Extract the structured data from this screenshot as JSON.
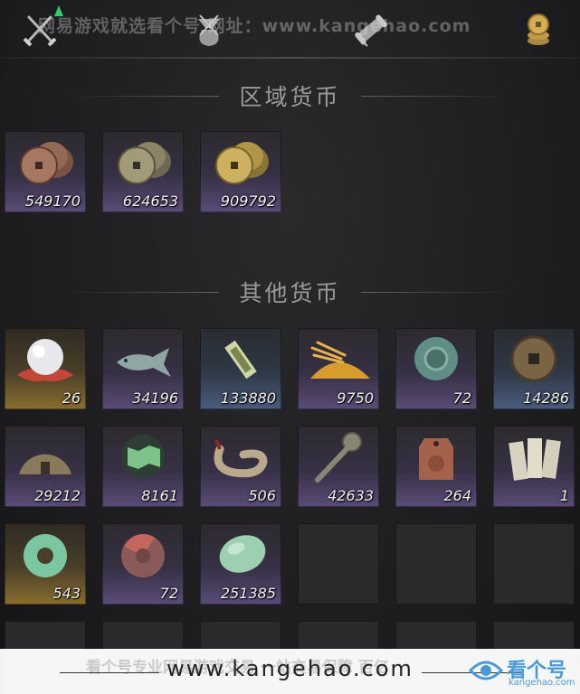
{
  "watermark": "网易游戏就选看个号  网址：www.kangehao.com",
  "tabs": [
    {
      "name": "swords-icon"
    },
    {
      "name": "pouch-icon"
    },
    {
      "name": "scroll-icon"
    },
    {
      "name": "coin-stack-icon"
    }
  ],
  "regional_currency": {
    "title": "区域货币",
    "items": [
      {
        "icon": "copper-coins-icon",
        "count": "549170",
        "rarity": "purple"
      },
      {
        "icon": "silver-coins-icon",
        "count": "624653",
        "rarity": "purple"
      },
      {
        "icon": "gold-coins-icon",
        "count": "909792",
        "rarity": "purple"
      }
    ]
  },
  "other_currency": {
    "title": "其他货币",
    "items": [
      {
        "icon": "pearl-icon",
        "count": "26",
        "rarity": "gold"
      },
      {
        "icon": "jade-fish-icon",
        "count": "34196",
        "rarity": "purple"
      },
      {
        "icon": "token-plaque-icon",
        "count": "133880",
        "rarity": "blue"
      },
      {
        "icon": "grain-pile-icon",
        "count": "9750",
        "rarity": "purple"
      },
      {
        "icon": "jade-disc-icon",
        "count": "72",
        "rarity": "purple"
      },
      {
        "icon": "bronze-coin-icon",
        "count": "14286",
        "rarity": "blue"
      },
      {
        "icon": "half-coin-icon",
        "count": "29212",
        "rarity": "purple"
      },
      {
        "icon": "green-map-icon",
        "count": "8161",
        "rarity": "purple"
      },
      {
        "icon": "coiled-rope-icon",
        "count": "506",
        "rarity": "purple"
      },
      {
        "icon": "coin-sword-icon",
        "count": "42633",
        "rarity": "purple"
      },
      {
        "icon": "copper-tag-icon",
        "count": "264",
        "rarity": "purple"
      },
      {
        "icon": "paper-slips-icon",
        "count": "1",
        "rarity": "purple"
      },
      {
        "icon": "jade-ring-icon",
        "count": "543",
        "rarity": "gold"
      },
      {
        "icon": "red-jade-disc-icon",
        "count": "72",
        "rarity": "purple"
      },
      {
        "icon": "jade-pebble-icon",
        "count": "251385",
        "rarity": "purple"
      }
    ]
  },
  "banner": {
    "url": "www.kangehao.com",
    "faint_text": "看个号专业网易游戏交易 一站交易保障 百亿",
    "brand_name": "看个号",
    "brand_sub": "kangehao.com"
  }
}
